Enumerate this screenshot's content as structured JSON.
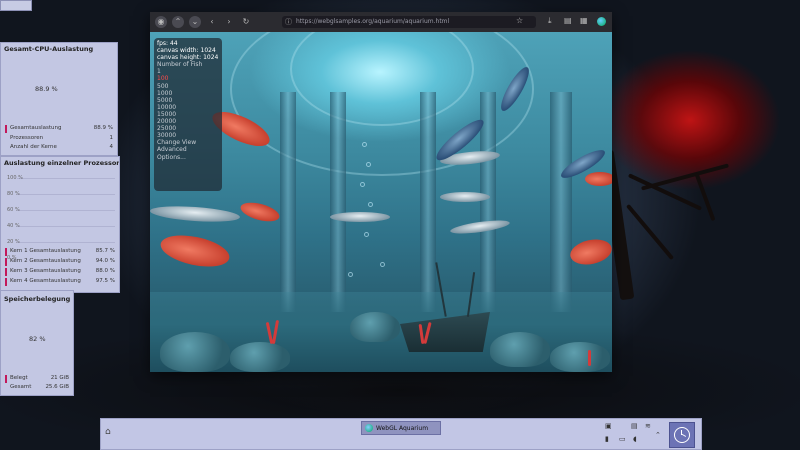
{
  "sysmon": {
    "cpu_total": {
      "title": "Gesamt-CPU-Auslastung",
      "value": "88.9 %",
      "rows": [
        {
          "label": "Gesamtauslastung",
          "value": "88.9 %"
        },
        {
          "label": "Prozessoren",
          "value": "1"
        },
        {
          "label": "Anzahl der Kerne",
          "value": "4"
        }
      ]
    },
    "per_core": {
      "title": "Auslastung einzelner Prozessorke...",
      "axis": [
        "100 %",
        "80 %",
        "60 %",
        "40 %",
        "20 %",
        "0 %"
      ],
      "rows": [
        {
          "label": "Kern 1 Gesamtauslastung",
          "value": "85.7 %"
        },
        {
          "label": "Kern 2 Gesamtauslastung",
          "value": "94.0 %"
        },
        {
          "label": "Kern 3 Gesamtauslastung",
          "value": "88.0 %"
        },
        {
          "label": "Kern 4 Gesamtauslastung",
          "value": "97.5 %"
        }
      ]
    },
    "memory": {
      "title": "Speicherbelegung",
      "value": "82 %",
      "rows": [
        {
          "label": "Belegt",
          "value": "21 GiB"
        },
        {
          "label": "Gesamt",
          "value": "25.6 GiB"
        }
      ]
    }
  },
  "browser": {
    "url": "https://webglsamples.org/aquarium/aquarium.html",
    "overlay": {
      "fps": "fps: 44",
      "canvas_width": "canvas width: 1024",
      "canvas_height": "canvas height: 1024",
      "number_label": "Number of Fish",
      "options": [
        "1",
        "100",
        "500",
        "1000",
        "5000",
        "10000",
        "15000",
        "20000",
        "25000",
        "30000"
      ],
      "selected": "100",
      "change_view": "Change View",
      "advanced": "Advanced",
      "options_label": "Options..."
    }
  },
  "taskbar": {
    "task_label": "WebGL Aquarium"
  },
  "colors": {
    "panel_bg": "#c3c7e3",
    "accent": "#c2185b",
    "overlay_selected": "#ff4b4b"
  }
}
